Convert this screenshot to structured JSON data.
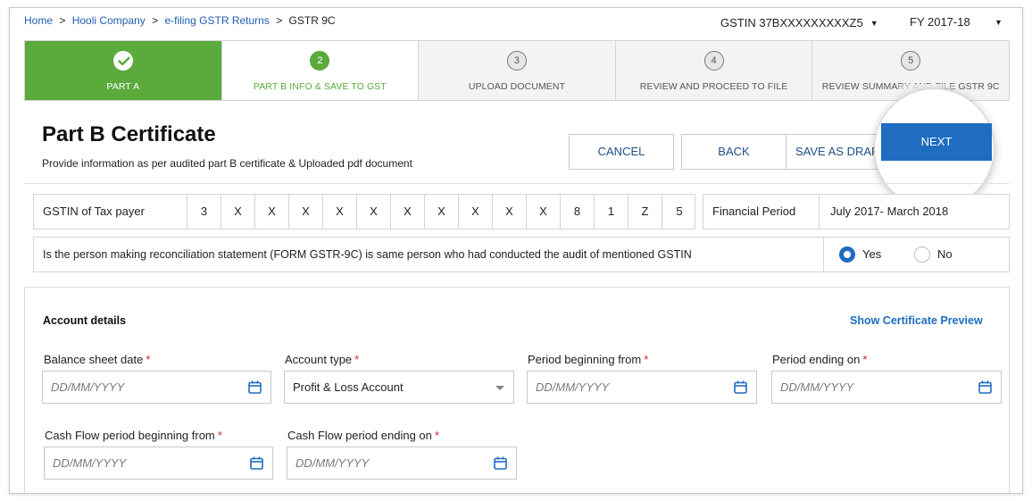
{
  "breadcrumb": {
    "items": [
      "Home",
      "Hooli Company",
      "e-filing GSTR Returns",
      "GSTR 9C"
    ],
    "separator": ">"
  },
  "header": {
    "gstin_selector": "GSTIN 37BXXXXXXXXXZ5",
    "fy_selector": "FY 2017-18"
  },
  "steps": [
    {
      "number": "",
      "label": "PART A",
      "state": "done"
    },
    {
      "number": "2",
      "label": "PART B INFO & SAVE TO GST",
      "state": "active"
    },
    {
      "number": "3",
      "label": "UPLOAD DOCUMENT",
      "state": "pending"
    },
    {
      "number": "4",
      "label": "REVIEW AND PROCEED TO FILE",
      "state": "pending"
    },
    {
      "number": "5",
      "label": "REVIEW SUMMARY AND FILE GSTR 9C",
      "state": "pending"
    }
  ],
  "page": {
    "title": "Part B Certificate",
    "subtitle": "Provide information as per audited part B certificate & Uploaded pdf document"
  },
  "actions": {
    "cancel": "CANCEL",
    "back": "BACK",
    "save_draft": "SAVE AS DRAFT",
    "next": "NEXT"
  },
  "gstin_row": {
    "label": "GSTIN of Tax payer",
    "chars": [
      "3",
      "X",
      "X",
      "X",
      "X",
      "X",
      "X",
      "X",
      "X",
      "X",
      "X",
      "8",
      "1",
      "Z",
      "5"
    ]
  },
  "financial_period": {
    "label": "Financial Period",
    "value": "July 2017- March 2018"
  },
  "question": {
    "text": "Is the person making reconciliation statement (FORM GSTR-9C) is same person who had conducted the audit of mentioned GSTIN",
    "yes_label": "Yes",
    "no_label": "No",
    "selected": "Yes"
  },
  "account": {
    "title": "Account details",
    "preview_link": "Show Certificate Preview",
    "fields": [
      {
        "label": "Balance sheet date",
        "placeholder": "DD/MM/YYYY",
        "value": ""
      },
      {
        "label": "Account type",
        "placeholder": "",
        "value": "Profit & Loss Account"
      },
      {
        "label": "Period beginning from",
        "placeholder": "DD/MM/YYYY",
        "value": ""
      },
      {
        "label": "Period ending on",
        "placeholder": "DD/MM/YYYY",
        "value": ""
      },
      {
        "label": "Cash Flow period beginning from",
        "placeholder": "DD/MM/YYYY",
        "value": ""
      },
      {
        "label": "Cash Flow period ending on",
        "placeholder": "DD/MM/YYYY",
        "value": ""
      }
    ],
    "required_mark": "*"
  },
  "colors": {
    "step_done": "#5aaa3c",
    "primary": "#1f6cc0",
    "link": "#1f5fb0",
    "required": "#d2232a"
  },
  "icons": {
    "step_done": "check-icon",
    "date_field": "calendar-icon",
    "dropdown": "caret-down-icon"
  }
}
